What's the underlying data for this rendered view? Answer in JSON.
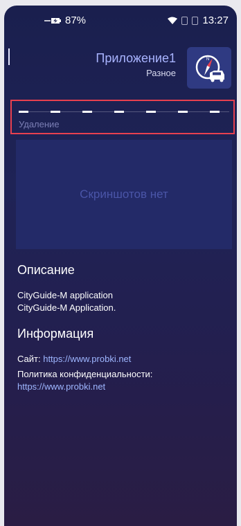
{
  "status_bar": {
    "battery": "87%",
    "time": "13:27"
  },
  "app": {
    "name": "Приложение1",
    "category": "Разное"
  },
  "download": {
    "label": "Удаление"
  },
  "screenshots": {
    "empty_text": "Скриншотов нет"
  },
  "description": {
    "title": "Описание",
    "line1": "CityGuide-M application",
    "line2": "CityGuide-M Application."
  },
  "info": {
    "title": "Информация",
    "site_label": "Сайт:",
    "site_url": "https://www.probki.net",
    "privacy_label": "Политика конфиденциальности:",
    "privacy_url": "https://www.probki.net"
  },
  "colors": {
    "accent_link": "#9eb6ff",
    "highlight_border": "#e8404f",
    "app_icon_bg": "#2f3a82"
  }
}
